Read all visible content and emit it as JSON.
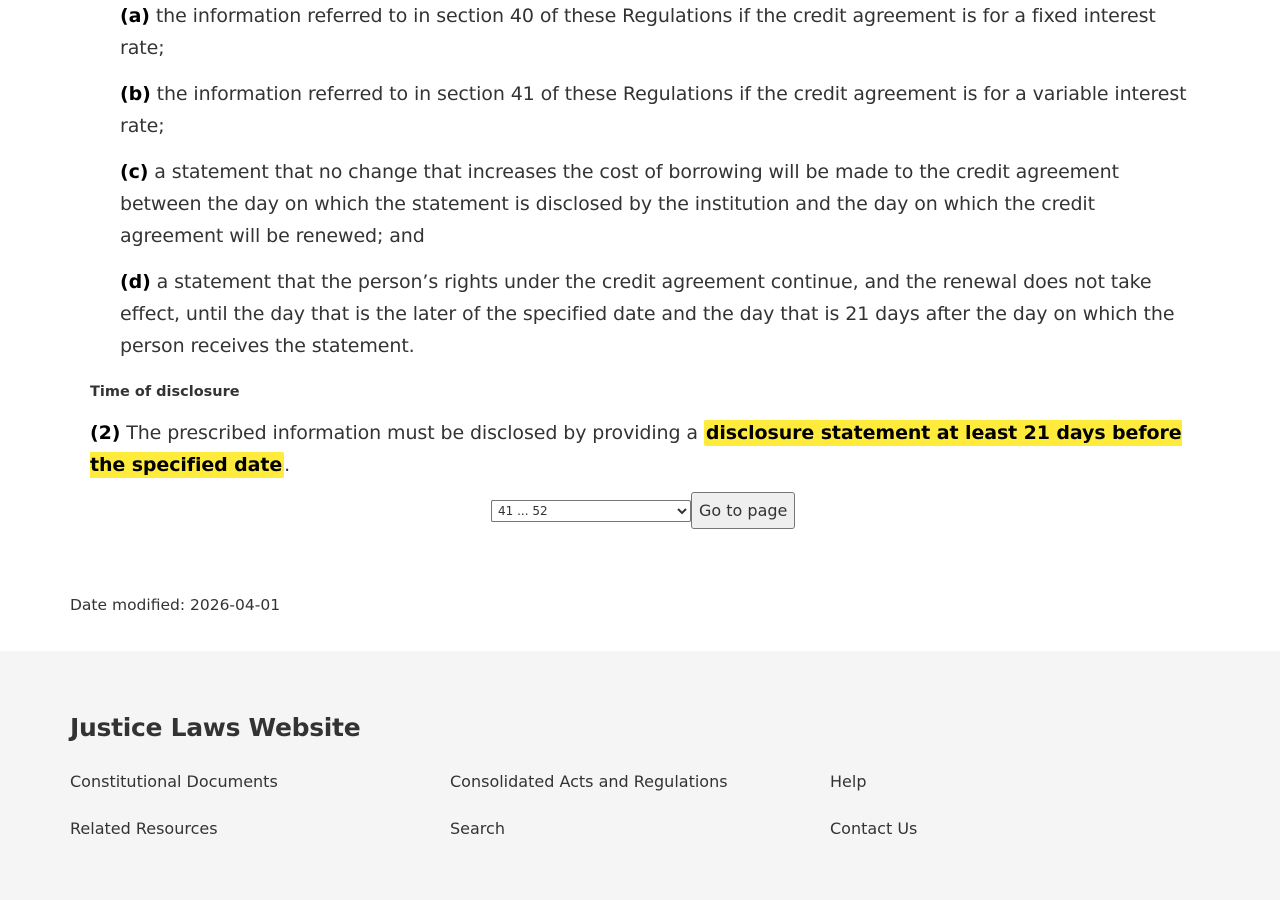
{
  "content": {
    "items": [
      {
        "label": "(a)",
        "text": " the information referred to in section 40 of these Regulations if the credit agreement is for a fixed interest rate;"
      },
      {
        "label": "(b)",
        "text": " the information referred to in section 41 of these Regulations if the credit agreement is for a variable interest rate;"
      },
      {
        "label": "(c)",
        "text": " a statement that no change that increases the cost of borrowing will be made to the credit agreement between the day on which the statement is disclosed by the institution and the day on which the credit agreement will be renewed; and"
      },
      {
        "label": "(d)",
        "text": " a statement that the person’s rights under the credit agreement continue, and the renewal does not take effect, until the day that is the later of the specified date and the day that is 21 days after the day on which the person receives the statement."
      }
    ],
    "heading": "Time of disclosure",
    "subsection": {
      "label": "(2)",
      "text_before": " The prescribed information must be disclosed by providing a ",
      "highlight": "disclosure statement at least 21 days before the specified date",
      "text_after": "."
    }
  },
  "pager": {
    "selected": "41 ... 52",
    "button_label": "Go to page"
  },
  "date_modified": "Date modified: 2026-04-01",
  "footer": {
    "title": "Justice Laws Website",
    "links": {
      "constitutional": "Constitutional Documents",
      "consolidated": "Consolidated Acts and Regulations",
      "help": "Help",
      "related": "Related Resources",
      "search": "Search",
      "contact": "Contact Us"
    }
  },
  "colors": {
    "highlight": "#ffeb3b",
    "footer_bg": "#f5f5f5",
    "text": "#333333"
  }
}
